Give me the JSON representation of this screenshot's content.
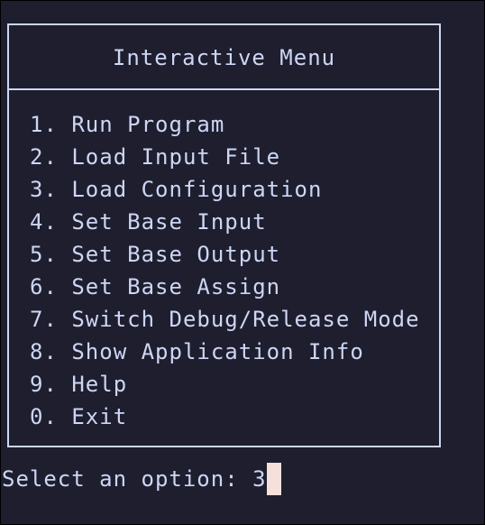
{
  "menu": {
    "title": "Interactive Menu",
    "items": [
      {
        "label": "1. Run Program"
      },
      {
        "label": "2. Load Input File"
      },
      {
        "label": "3. Load Configuration"
      },
      {
        "label": "4. Set Base Input"
      },
      {
        "label": "5. Set Base Output"
      },
      {
        "label": "6. Set Base Assign"
      },
      {
        "label": "7. Switch Debug/Release Mode"
      },
      {
        "label": "8. Show Application Info"
      },
      {
        "label": "9. Help"
      },
      {
        "label": "0. Exit"
      }
    ]
  },
  "prompt": {
    "text": "Select an option: ",
    "input_value": "3"
  },
  "colors": {
    "background": "#1e1e2e",
    "foreground": "#cdd6f4",
    "cursor": "#f5e0dc"
  }
}
